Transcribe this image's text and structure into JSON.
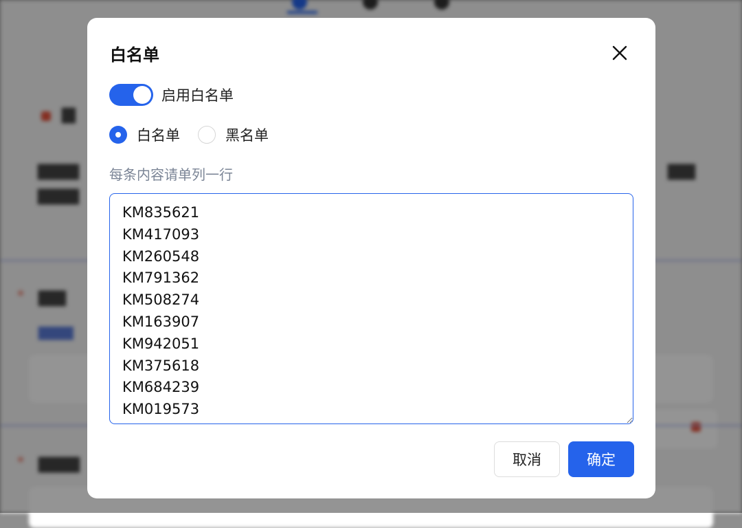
{
  "dialog": {
    "title": "白名单",
    "toggle": {
      "label": "启用白名单",
      "enabled": true
    },
    "list_type": {
      "options": [
        "白名单",
        "黑名单"
      ],
      "selected": "白名单"
    },
    "hint": "每条内容请单列一行",
    "entries_text": "KM835621\nKM417093\nKM260548\nKM791362\nKM508274\nKM163907\nKM942051\nKM375618\nKM684239\nKM019573",
    "cancel_label": "取消",
    "ok_label": "确定"
  },
  "colors": {
    "accent": "#2563eb",
    "hint_text": "#7b8596",
    "overlay": "rgba(0,0,0,0.42)"
  }
}
